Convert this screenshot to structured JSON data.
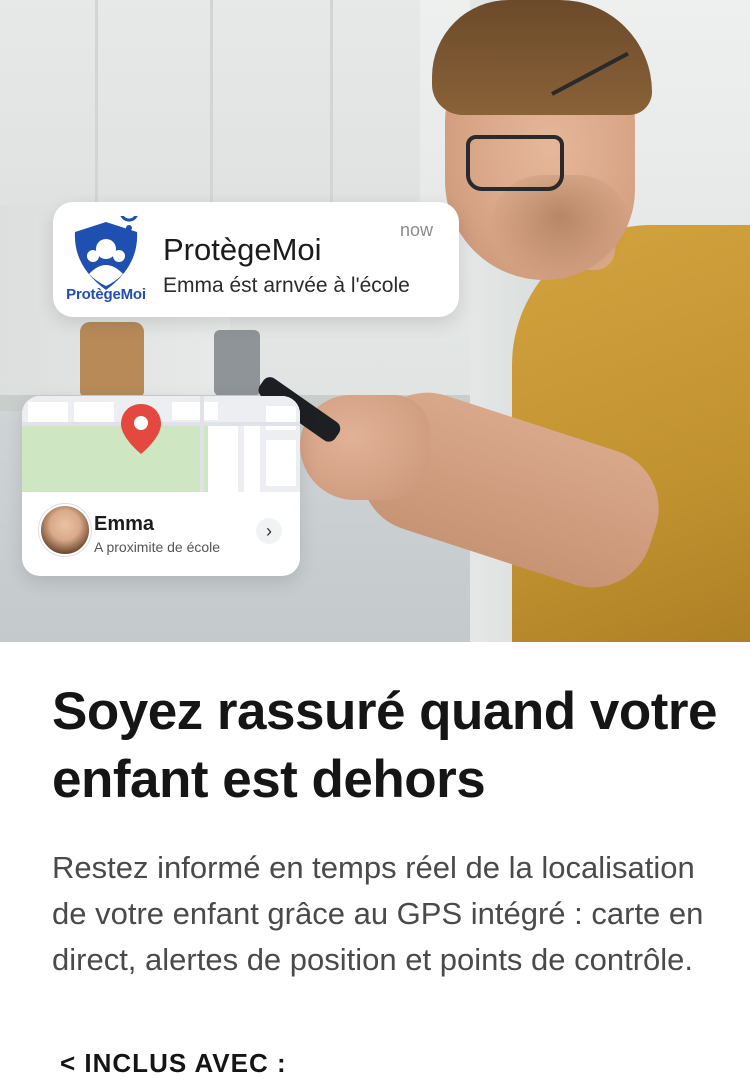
{
  "notification": {
    "app_name": "ProtègeMoi",
    "logo_text": "ProtègeMoi",
    "message": "Emma ést arnvée à l'école",
    "time": "now",
    "logo_icon": "family-shield-logo"
  },
  "map_card": {
    "child_name": "Emma",
    "status": "A proximite de école",
    "pin_icon": "location-pin-icon",
    "chevron_icon": "chevron-right-icon",
    "chevron_glyph": "›",
    "pin_color": "#e5483f",
    "park_color": "#cfe6c3"
  },
  "content": {
    "headline": "Soyez rassuré quand votre enfant est dehors",
    "body": "Restez informé en temps réel de la localisation de votre enfant grâce au GPS intégré : carte en direct, alertes de position et points de contrôle.",
    "included_label": "< INCLUS AVEC :"
  }
}
